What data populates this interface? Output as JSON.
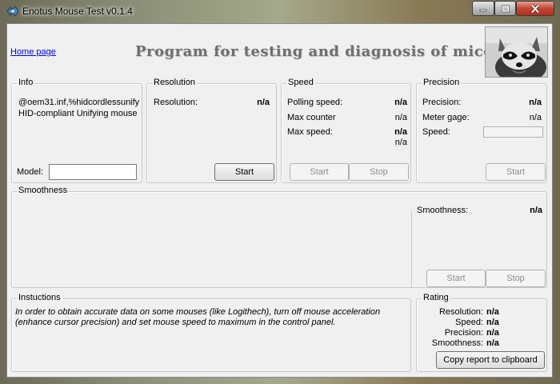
{
  "window": {
    "title": "Enotus Mouse Test v0.1.4"
  },
  "header": {
    "home_link": "Home page",
    "banner": "Program for testing and diagnosis of mice"
  },
  "info": {
    "title": "Info",
    "device_id": "@oem31.inf,%hidcordlessunify",
    "device_name": "HID-compliant Unifying mouse",
    "model_label": "Model:",
    "model_value": ""
  },
  "resolution": {
    "title": "Resolution",
    "label": "Resolution:",
    "value": "n/a",
    "start_label": "Start"
  },
  "speed": {
    "title": "Speed",
    "polling_label": "Polling speed:",
    "polling_value": "n/a",
    "max_counter_label": "Max counter",
    "max_counter_value": "n/a",
    "max_speed_label": "Max  speed:",
    "max_speed_value": "n/a",
    "max_speed_value2": "n/a",
    "start_label": "Start",
    "stop_label": "Stop"
  },
  "precision": {
    "title": "Precision",
    "precision_label": "Precision:",
    "precision_value": "n/a",
    "meter_label": "Meter gage:",
    "meter_value": "n/a",
    "speed_label": "Speed:",
    "start_label": "Start"
  },
  "smoothness": {
    "title": "Smoothness",
    "label": "Smoothness:",
    "value": "n/a",
    "start_label": "Start",
    "stop_label": "Stop"
  },
  "instructions": {
    "title": "Instuctions",
    "line1": "In order to obtain accurate data on some mouses (like Logithech), turn off mouse acceleration",
    "line2": "(enhance cursor precision) and set mouse speed to maximum in the control panel."
  },
  "rating": {
    "title": "Rating",
    "resolution_label": "Resolution:",
    "resolution_value": "n/a",
    "speed_label": "Speed:",
    "speed_value": "n/a",
    "precision_label": "Precision:",
    "precision_value": "n/a",
    "smoothness_label": "Smoothness:",
    "smoothness_value": "n/a",
    "copy_label": "Copy report to clipboard"
  }
}
